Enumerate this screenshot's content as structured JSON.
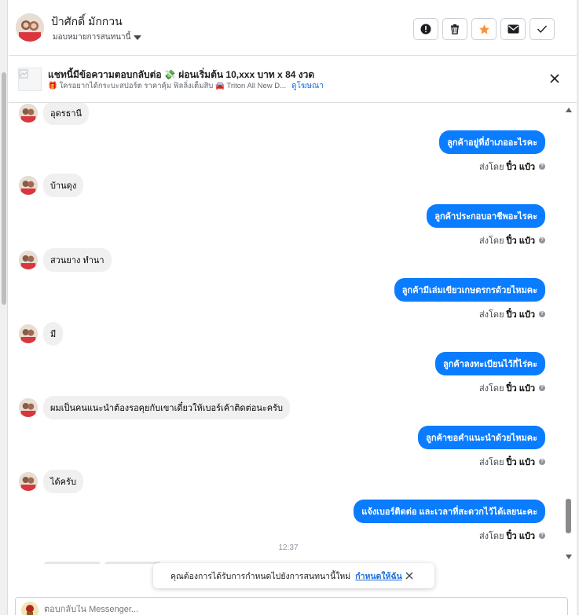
{
  "header": {
    "contact_name": "ป้าศักดิ์ มักกวน",
    "assignment_label": "มอบหมายการสนทนานี้",
    "actions": [
      {
        "icon": "alert-icon",
        "name": "mark-spam-button"
      },
      {
        "icon": "trash-icon",
        "name": "delete-button"
      },
      {
        "icon": "star-icon",
        "name": "star-button"
      },
      {
        "icon": "envelope-icon",
        "name": "mark-unread-button"
      },
      {
        "icon": "check-icon",
        "name": "mark-done-button"
      }
    ],
    "star_color": "#f7923b"
  },
  "ad_bar": {
    "title": "แชทนี้มีข้อความตอบกลับต่อ 💸 ผ่อนเริ่มต้น 10,xxx บาท x 84 งวด",
    "subtitle": "🎁 ใครอยากได้กระบะสปอร์ต ราคาคุ้ม ฟิลลิ่งเต็มสิบ 🚘 Triton All New D...",
    "link_text": "ดูโฆษณา"
  },
  "messages": [
    {
      "dir": "in",
      "text": "อุดรธานี"
    },
    {
      "dir": "out",
      "text": "ลูกค้าอยู่ที่อำเภออะไรคะ",
      "sent_by_prefix": "ส่งโดย",
      "sent_by_name": "ปิ๋ว แป๋ว"
    },
    {
      "dir": "in",
      "text": "บ้านดุง"
    },
    {
      "dir": "out",
      "text": "ลูกค้าประกอบอาชีพอะไรคะ",
      "sent_by_prefix": "ส่งโดย",
      "sent_by_name": "ปิ๋ว แป๋ว"
    },
    {
      "dir": "in",
      "text": "สวนยาง ทำนา"
    },
    {
      "dir": "out",
      "text": "ลูกค้ามีเล่มเขียวเกษตรกรด้วยไหมคะ",
      "sent_by_prefix": "ส่งโดย",
      "sent_by_name": "ปิ๋ว แป๋ว"
    },
    {
      "dir": "in",
      "text": "มี"
    },
    {
      "dir": "out",
      "text": "ลูกค้าลงทะเบียนไว้กี่ไร่คะ",
      "sent_by_prefix": "ส่งโดย",
      "sent_by_name": "ปิ๋ว แป๋ว"
    },
    {
      "dir": "in",
      "text": "ผมเป็นคนแนะนำต้องรอคุยกับเขาเดี๋ยวให้เบอร์เค้าติดต่อนะครับ"
    },
    {
      "dir": "out",
      "text": "ลูกค้าขอคำแนะนำด้วยไหมคะ",
      "sent_by_prefix": "ส่งโดย",
      "sent_by_name": "ปิ๋ว แป๋ว"
    },
    {
      "dir": "in",
      "text": "ได้ครับ"
    },
    {
      "dir": "out",
      "text": "แจ้งเบอร์ติดต่อ และเวลาที่สะดวกไว้ได้เลยนะคะ",
      "sent_by_prefix": "ส่งโดย",
      "sent_by_name": "ปิ๋ว แป๋ว"
    }
  ],
  "timestamp": "12:37",
  "toast": {
    "text": "คุณต้องการได้รับการกำหนดไปยังการสนทนานี้ใหม่",
    "link_text": "กำหนดให้ฉัน"
  },
  "composer": {
    "placeholder": "ตอบกลับใน Messenger..."
  },
  "colors": {
    "outgoing_bubble": "#0a7cff",
    "incoming_bubble": "#f0f0f0",
    "link": "#216fdb"
  }
}
